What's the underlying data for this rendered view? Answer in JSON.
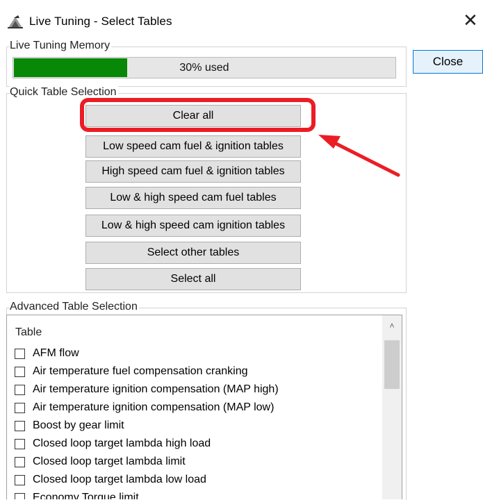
{
  "window": {
    "title": "Live Tuning - Select Tables",
    "close_glyph": "✕",
    "close_button": "Close",
    "app_icon": "tuning-app-icon"
  },
  "memory": {
    "group_label": "Live Tuning Memory",
    "used_fraction": 0.3,
    "used_text": "30% used",
    "bar_color": "#078807"
  },
  "quick": {
    "group_label": "Quick Table Selection",
    "buttons": [
      "Clear all",
      "Low speed cam fuel & ignition tables",
      "High speed cam fuel & ignition tables",
      "Low & high speed cam fuel tables",
      "Low & high speed cam ignition tables",
      "Select other tables",
      "Select all"
    ]
  },
  "advanced": {
    "group_label": "Advanced Table Selection",
    "column_header": "Table",
    "scroll_up_glyph": "˄",
    "items": [
      "AFM flow",
      "Air temperature fuel compensation cranking",
      "Air temperature ignition compensation (MAP high)",
      "Air temperature ignition compensation (MAP low)",
      "Boost by gear limit",
      "Closed loop target lambda high load",
      "Closed loop target lambda limit",
      "Closed loop target lambda low load",
      "Economy Torque limit"
    ]
  },
  "annotation": {
    "color": "#ec1c24"
  }
}
